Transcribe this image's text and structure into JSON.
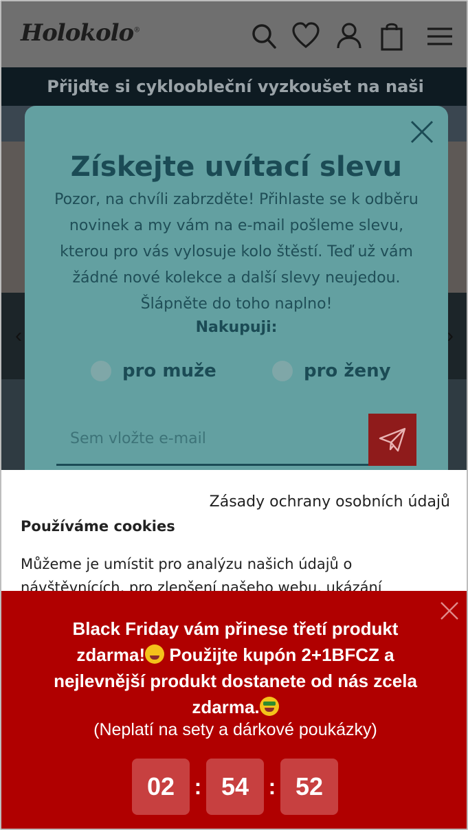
{
  "header": {
    "logo_text": "Holokolo",
    "logo_mark": "®",
    "icons": [
      "search-icon",
      "heart-icon",
      "user-icon",
      "bag-icon",
      "menu-icon"
    ]
  },
  "promo_bar": {
    "text": "Přijďte si cykloobleční vyzkoušet na naši"
  },
  "modal": {
    "title": "Získejte uvítací slevu",
    "text": "Pozor, na chvíli zabrzděte! Přihlaste se k odběru novinek a my vám na e-mail pošleme slevu, kterou pro vás vylosuje kolo štěstí. Teď už vám žádné nové kolekce a další slevy neujedou. Šlápněte do toho naplno!",
    "shopping_label": "Nakupuji:",
    "options": [
      "pro muže",
      "pro ženy"
    ],
    "email_placeholder": "Sem vložte e-mail"
  },
  "cookie": {
    "privacy_link": "Zásady ochrany osobních údajů",
    "title": "Používáme cookies",
    "text": "Můžeme je umístit pro analýzu našich údajů o návštěvnících, pro zlepšení našeho webu, ukázání"
  },
  "black_friday": {
    "line1": "Black Friday vám přinese třetí produkt zdarma!",
    "line2": " Použijte kupón 2+1BFCZ a nejlevnější produkt dostanete od nás zcela zdarma.",
    "note": "(Neplatí na sety a dárkové poukázky)",
    "timer": {
      "hours": "02",
      "minutes": "54",
      "seconds": "52",
      "separator": ":"
    }
  },
  "colors": {
    "modal_bg": "#63a0a1",
    "modal_text": "#1b4b55",
    "banner_bg": "#b00000",
    "send_button": "#8f1b1b"
  }
}
